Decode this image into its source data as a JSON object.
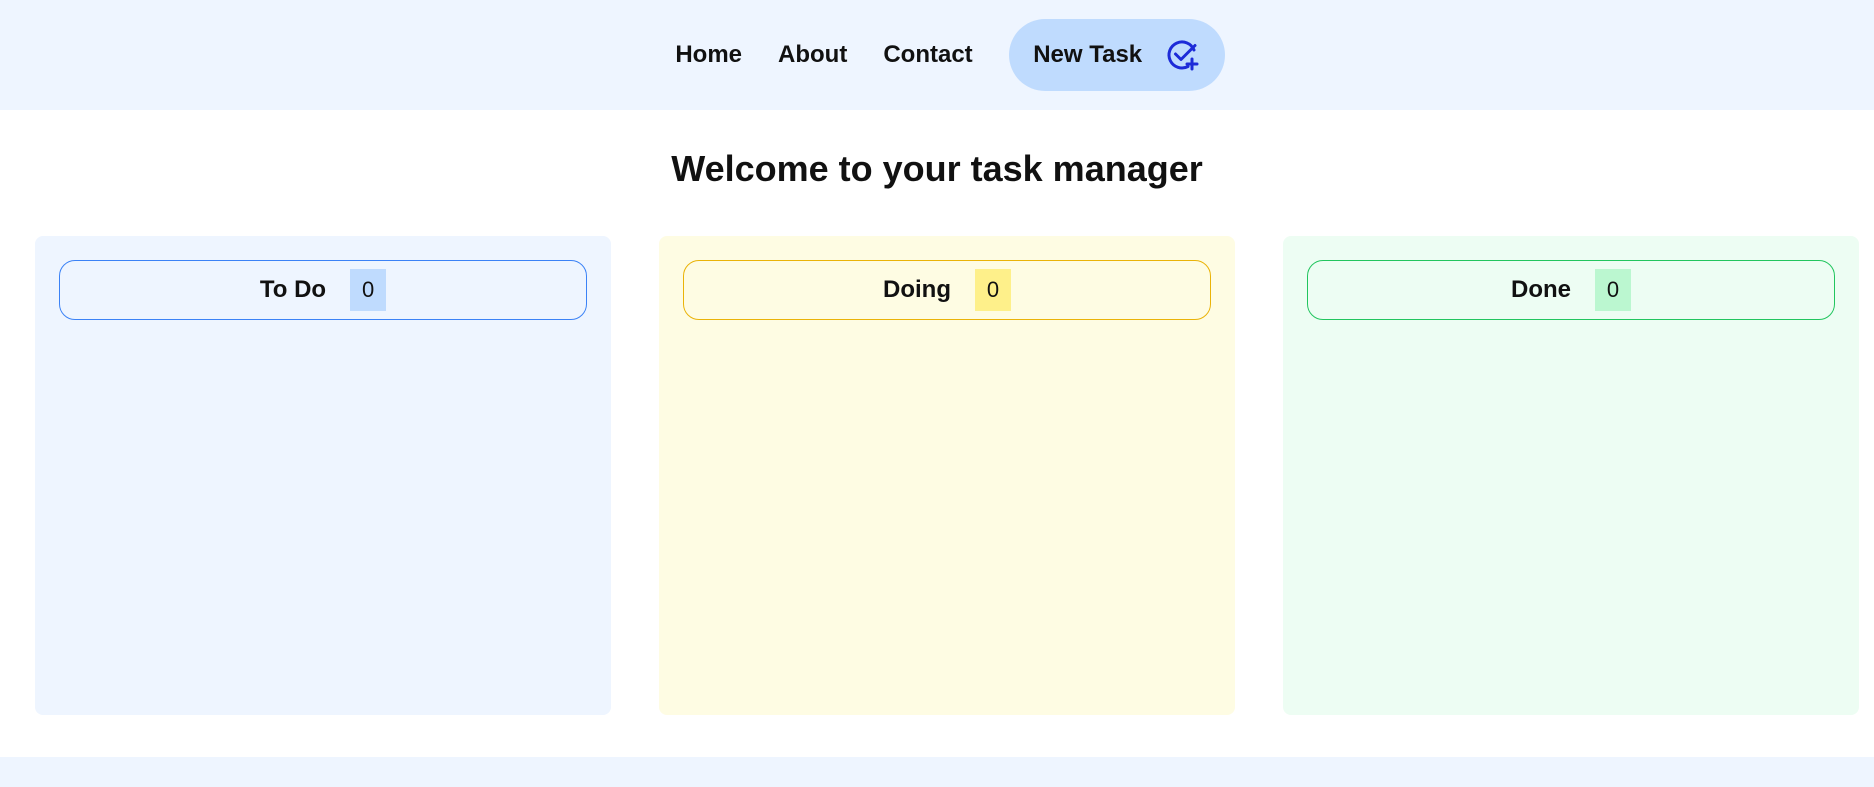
{
  "nav": {
    "home": "Home",
    "about": "About",
    "contact": "Contact",
    "new_task": "New Task",
    "new_task_icon": "check-circle-plus-icon"
  },
  "main": {
    "title": "Welcome to your task manager"
  },
  "columns": [
    {
      "name": "To Do",
      "count": "0",
      "color": "#3b82f6"
    },
    {
      "name": "Doing",
      "count": "0",
      "color": "#eab308"
    },
    {
      "name": "Done",
      "count": "0",
      "color": "#22c55e"
    }
  ],
  "colors": {
    "header_bg": "#eef5ff",
    "button_bg": "#bfdbfe",
    "icon": "#1d2bd8"
  }
}
